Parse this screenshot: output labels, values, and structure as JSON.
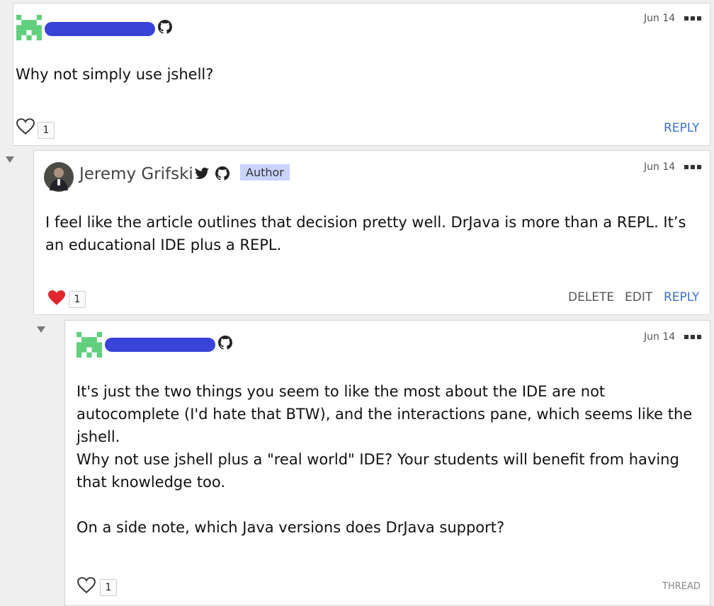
{
  "comments": [
    {
      "date": "Jun 14",
      "body": [
        "Why not simply use jshell?"
      ],
      "likes": "1",
      "actions": {
        "reply": "REPLY"
      }
    },
    {
      "author": "Jeremy Grifski",
      "badge": "Author",
      "date": "Jun 14",
      "body": [
        "I feel like the article outlines that decision pretty well. DrJava is more than a REPL. It’s",
        "an educational IDE plus a REPL."
      ],
      "likes": "1",
      "actions": {
        "delete": "DELETE",
        "edit": "EDIT",
        "reply": "REPLY"
      }
    },
    {
      "date": "Jun 14",
      "body": [
        "It's just the two things you seem to like the most about the IDE are not",
        "autocomplete (I'd hate that BTW), and the interactions pane, which seems like the",
        "jshell.",
        "Why not use jshell plus a \"real world\" IDE? Your students will benefit from having",
        "that knowledge too.",
        "",
        "On a side note, which Java versions does DrJava support?"
      ],
      "likes": "1",
      "actions": {
        "thread": "THREAD"
      }
    }
  ],
  "colors": {
    "accent": "#3d6fc9",
    "identicon": "#5fcf7c",
    "heart_liked": "#e0262e",
    "redaction": "#3a43d8"
  },
  "icons": [
    "github-icon",
    "twitter-icon",
    "heart-icon",
    "more-icon",
    "collapse-arrow-icon"
  ]
}
